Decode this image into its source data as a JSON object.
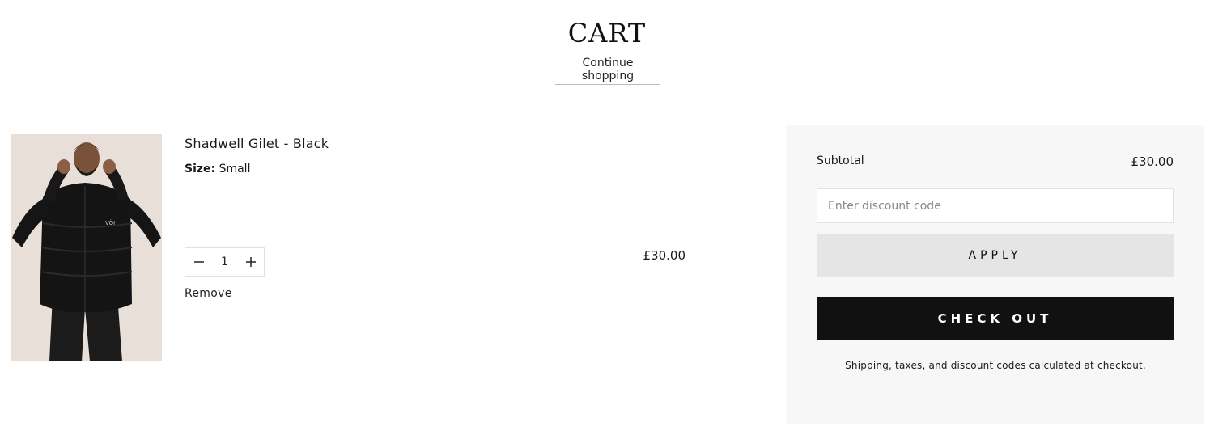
{
  "header": {
    "title": "CART",
    "continue_label": "Continue shopping"
  },
  "cart": {
    "items": [
      {
        "name": "Shadwell Gilet - Black",
        "variant_label": "Size:",
        "variant_value": "Small",
        "quantity": "1",
        "price": "£30.00",
        "remove_label": "Remove",
        "image_icon": "product-photo-model-black-gilet"
      }
    ]
  },
  "summary": {
    "subtotal_label": "Subtotal",
    "subtotal_value": "£30.00",
    "discount_placeholder": "Enter discount code",
    "apply_label": "APPLY",
    "checkout_label": "CHECK OUT",
    "shipping_note": "Shipping, taxes, and discount codes calculated at checkout."
  },
  "colors": {
    "checkout_bg": "#111111",
    "apply_bg": "#e5e5e5",
    "summary_bg": "#f7f7f7",
    "image_bg": "#e8dfd9"
  }
}
